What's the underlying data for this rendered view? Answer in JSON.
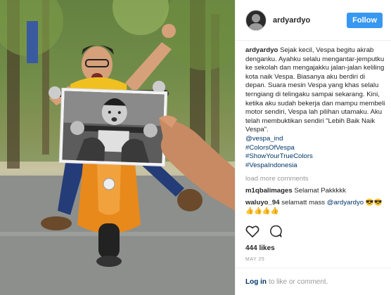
{
  "post": {
    "username": "ardyardyo",
    "follow_label": "Follow",
    "caption_user": "ardyardyo",
    "caption_text": "Sejak kecil, Vespa begitu akrab denganku. Ayahku selalu mengantar-jemputku ke sekolah dan mengajakku jalan-jalan keliling kota naik Vespa. Biasanya aku berdiri di depan. Suara mesin Vespa yang khas selalu terngiang di telingaku sampai sekarang. Kini, ketika aku sudah bekerja dan mampu membeli motor sendiri, Vespa lah pilihan utamaku. Aku telah membuktikan sendiri \"Lebih Baik Naik Vespa\".",
    "tags": [
      "@vespa_ind",
      "#ColorsOfVespa",
      "#ShowYourTrueColors",
      "#VespaIndonesia"
    ],
    "load_more": "load more comments",
    "comments": [
      {
        "user": "m1qbalimages",
        "text": "Selamat Pakkkkk"
      },
      {
        "user": "waluyo_94",
        "text": "selamatt mass",
        "mention": "@ardyardyo",
        "emoji": "😎😎👍👍👍👍"
      }
    ],
    "likes": "444 likes",
    "date": "MAY 25",
    "footer_login": "Log in",
    "footer_text": "to like or comment.",
    "icons": {
      "like": "heart-icon",
      "comment": "comment-bubble-icon"
    },
    "colors": {
      "follow": "#3897f0",
      "link": "#003569",
      "muted": "#999999"
    }
  }
}
